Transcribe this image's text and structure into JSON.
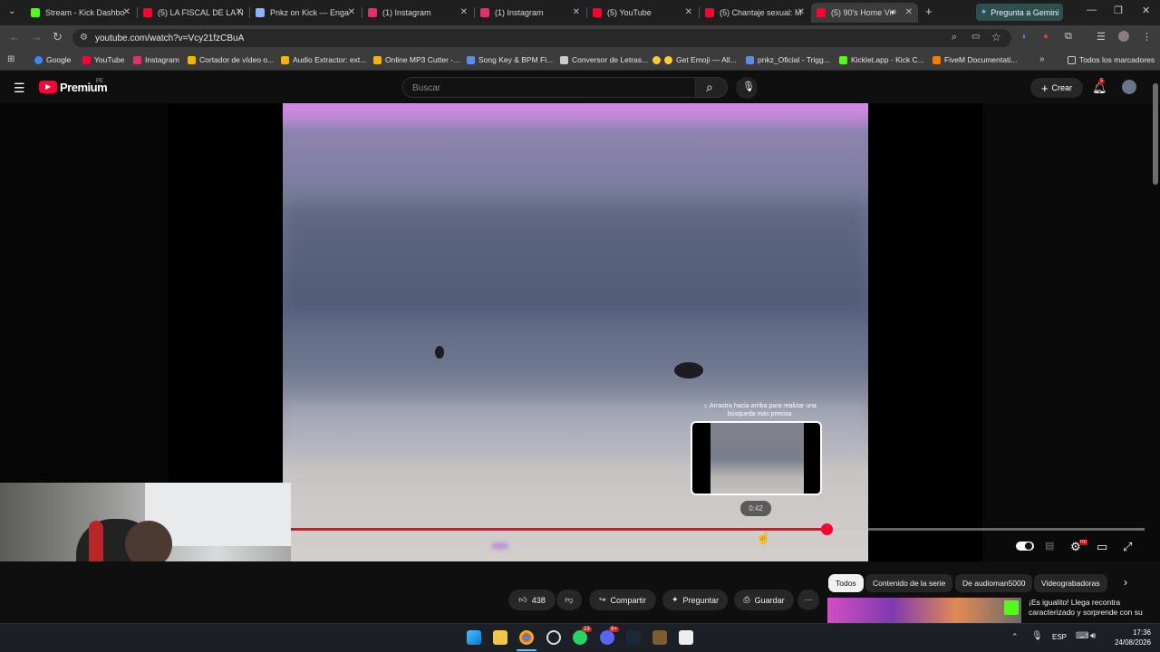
{
  "browser": {
    "tabs": [
      {
        "label": "Stream - Kick Dashbo",
        "favicon_color": "#53fc18"
      },
      {
        "label": "(5) LA FISCAL DE LA N",
        "favicon_color": "#ff0033"
      },
      {
        "label": "Pnkz on Kick — Enga",
        "favicon_color": "#8ab4f8"
      },
      {
        "label": "(1) Instagram",
        "favicon_color": "#e1306c"
      },
      {
        "label": "(1) Instagram",
        "favicon_color": "#e1306c"
      },
      {
        "label": "(5) YouTube",
        "favicon_color": "#ff0033"
      },
      {
        "label": "(5) Chantaje sexual: M",
        "favicon_color": "#ff0033"
      },
      {
        "label": "(5) 90's Home Vic",
        "favicon_color": "#ff0033",
        "active": true
      }
    ],
    "gemini_button": "Pregunta a Gemini",
    "url": "youtube.com/watch?v=Vcy21fzCBuA",
    "bookmarks": [
      {
        "label": "Google",
        "icon_color": "#4285f4"
      },
      {
        "label": "YouTube",
        "icon_color": "#ff0033"
      },
      {
        "label": "Instagram",
        "icon_color": "#e1306c"
      },
      {
        "label": "Cortador de vídeo o...",
        "icon_color": "#f4b400"
      },
      {
        "label": "Audio Extractor: ext...",
        "icon_color": "#f4b400"
      },
      {
        "label": "Online MP3 Cutter -...",
        "icon_color": "#f4b400"
      },
      {
        "label": "Song Key & BPM Fi...",
        "icon_color": "#5b8def"
      },
      {
        "label": "Conversor de Letras...",
        "icon_color": "#cccccc"
      },
      {
        "label": "Get Emoji — All...",
        "icon_color": "#ffcc33"
      },
      {
        "label": "pnkz_Oficial - Trigg...",
        "icon_color": "#5b8def"
      },
      {
        "label": "Kicklet.app - Kick C...",
        "icon_color": "#53fc18"
      },
      {
        "label": "FiveM Documentati...",
        "icon_color": "#f57c00"
      }
    ],
    "all_bookmarks": "Todos los marcadores"
  },
  "youtube": {
    "logo": "Premium",
    "region": "PE",
    "search_placeholder": "Buscar",
    "create_label": "Crear",
    "notification_count": "5",
    "player": {
      "drag_hint": "Arrastra hacia arriba para realizar una búsqueda más precisa",
      "hover_time": "0:42",
      "progress_fraction": 0.628
    },
    "actions": {
      "likes": "438",
      "share": "Compartir",
      "ask": "Preguntar",
      "save": "Guardar"
    },
    "chips": [
      "Todos",
      "Contenido de la serie",
      "De audioman5000",
      "Videograbadoras"
    ],
    "recommended_title": "¡Es igualito! Llega recontra caracterizado y sorprende con su"
  },
  "taskbar": {
    "language": "ESP",
    "time": "17:36",
    "date": "24/08/2026",
    "badges": [
      "23",
      "9+"
    ]
  }
}
